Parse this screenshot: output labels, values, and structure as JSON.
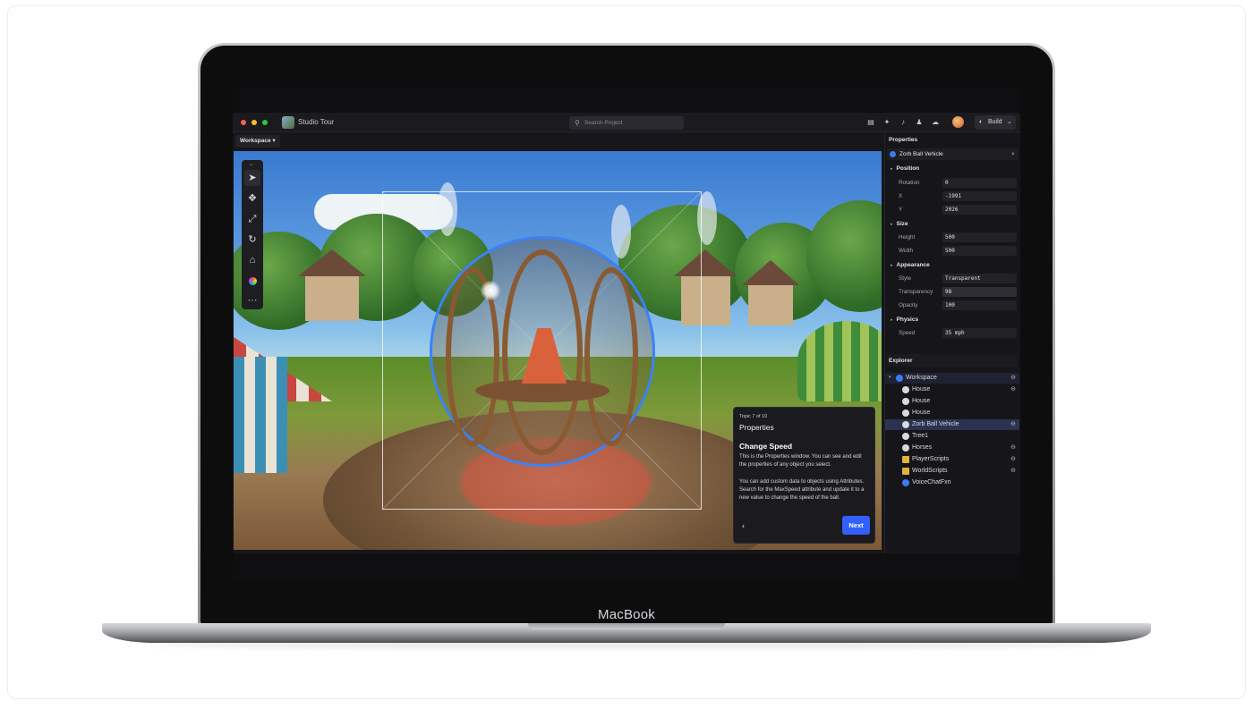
{
  "device": {
    "brand_label": "MacBook"
  },
  "titlebar": {
    "app_title": "Studio Tour",
    "search_placeholder": "Search Project",
    "build_label": "Build",
    "icons": [
      "notes-icon",
      "sparkle-icon",
      "bell-icon",
      "people-icon",
      "cloud-icon"
    ]
  },
  "workspace_button": {
    "label": "Workspace",
    "caret": "▾"
  },
  "toolbar": {
    "tools": [
      "select-tool",
      "move-tool",
      "scale-tool",
      "rotate-tool",
      "transform-tool",
      "color-tool",
      "more-tool"
    ],
    "more_label": "···"
  },
  "tour": {
    "topic": "Topic 7 of 10",
    "section": "Properties",
    "heading": "Change Speed",
    "paragraph1": "This is the Properties window. You can see and edit the properties of any object you select.",
    "paragraph2": "You can add custom data to objects using Attributes. Search for the MaxSpeed attribute and update it to a new value to change the speed of the ball.",
    "back_label": "‹",
    "next_label": "Next"
  },
  "properties": {
    "title": "Properties",
    "selected_object": "Zorb Ball Vehicle",
    "groups": {
      "position": {
        "label": "Position",
        "rotation_label": "Rotation",
        "rotation": "0",
        "x_label": "X",
        "x": "-1991",
        "y_label": "Y",
        "y": "2026"
      },
      "size": {
        "label": "Size",
        "height_label": "Height",
        "height": "500",
        "width_label": "Width",
        "width": "500"
      },
      "appearance": {
        "label": "Appearance",
        "style_label": "Style",
        "style": "Transparent",
        "transparency_label": "Transparency",
        "transparency": "98",
        "opacity_label": "Opacity",
        "opacity": "100"
      },
      "physics": {
        "label": "Physics",
        "speed_label": "Speed",
        "speed": "35 mph"
      }
    }
  },
  "explorer": {
    "title": "Explorer",
    "items": [
      {
        "label": "Workspace"
      },
      {
        "label": "House"
      },
      {
        "label": "House"
      },
      {
        "label": "House"
      },
      {
        "label": "Zorb Ball Vehicle"
      },
      {
        "label": "Tree1"
      },
      {
        "label": "Horses"
      },
      {
        "label": "PlayerScripts"
      },
      {
        "label": "WorldScripts"
      },
      {
        "label": "VoiceChatFxn"
      }
    ]
  },
  "colors": {
    "accent": "#335fff",
    "selection_outline": "#3b82f6"
  }
}
